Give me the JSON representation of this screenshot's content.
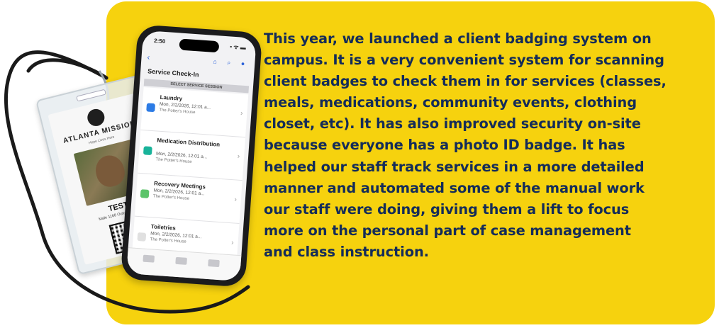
{
  "colors": {
    "panel": "#f6d20e",
    "text": "#142c59"
  },
  "body_lines": [
    "This year, we launched a client badging system on",
    "campus. It is a very convenient system for scanning",
    "client badges to check them in for services (classes,",
    "meals, medications, community events, clothing",
    "closet, etc). It has also improved security on-site",
    "because everyone has a photo ID badge. It has",
    "helped our staff track services in a more detailed",
    "manner and automated some of the manual work",
    "our staff were doing, giving them a lift to focus",
    "more on the personal part of case management",
    "and class instruction."
  ],
  "phone": {
    "time": "2:50",
    "signal": "▪ ᯤ ▬",
    "back": "‹",
    "nav_icons": "⌂ ⌕ ●",
    "title": "Service Check-In",
    "section": "SELECT SERVICE SESSION",
    "items": [
      {
        "name": "Laundry",
        "date": "Mon, 2/2/2026, 12:01 a...",
        "place": "The Potter's House",
        "color": "#2c7be5"
      },
      {
        "name": "Medication Distribution",
        "date": "Mon, 2/2/2026, 12:01 a...",
        "place": "The Potter's House",
        "color": "#19b39a"
      },
      {
        "name": "Recovery Meetings",
        "date": "Mon, 2/2/2026, 12:01 a...",
        "place": "The Potter's House",
        "color": "#5cc46a"
      },
      {
        "name": "Toiletries",
        "date": "Mon, 2/2/2026, 12:01 a...",
        "place": "The Potter's House",
        "color": "#e0e0e0"
      }
    ]
  },
  "badge": {
    "org": "ATLANTA MISSION",
    "org_sub": "Hope Lives Here",
    "name": "TEST",
    "subtitle": "Male 1168 Outcomes MP"
  }
}
